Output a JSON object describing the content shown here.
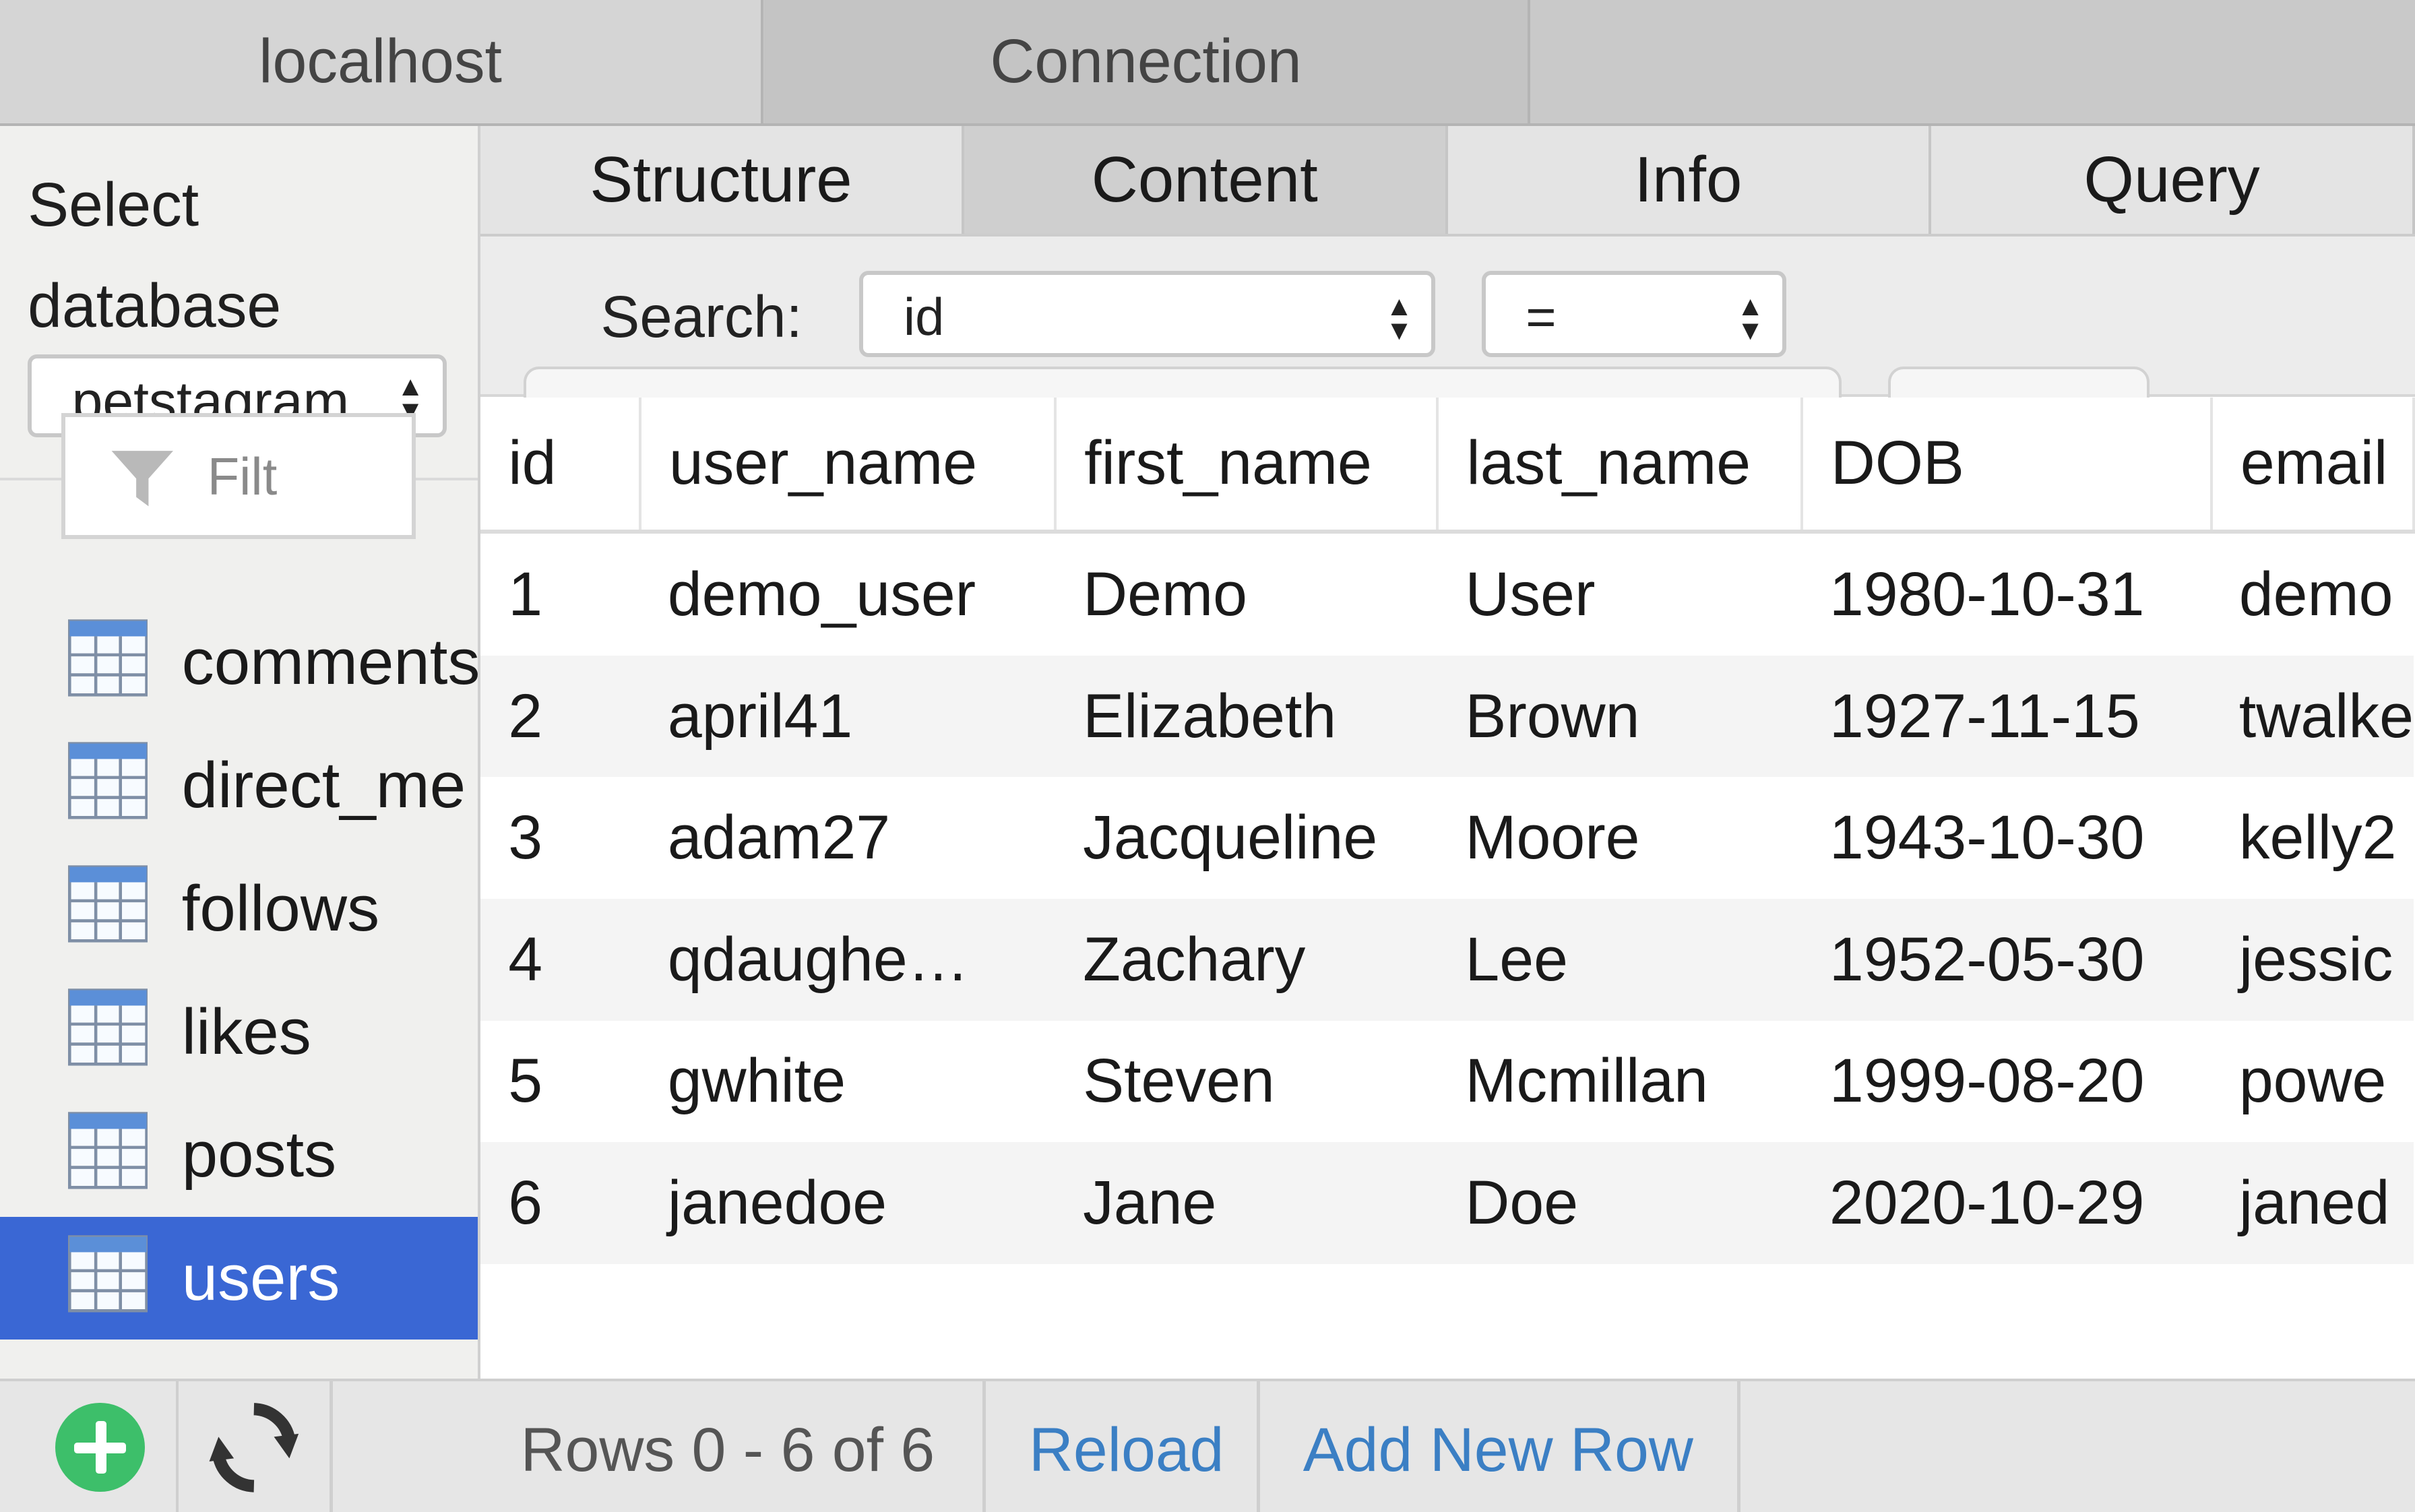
{
  "top_tabs": [
    "localhost",
    "Connection"
  ],
  "sidebar": {
    "select_label": "Select database",
    "database": "petstagram",
    "filter_placeholder": "Filt",
    "tables": [
      {
        "label": "comments",
        "active": false
      },
      {
        "label": "direct_me",
        "active": false
      },
      {
        "label": "follows",
        "active": false
      },
      {
        "label": "likes",
        "active": false
      },
      {
        "label": "posts",
        "active": false
      },
      {
        "label": "users",
        "active": true
      }
    ]
  },
  "tabs": [
    {
      "label": "Structure",
      "active": false
    },
    {
      "label": "Content",
      "active": true
    },
    {
      "label": "Info",
      "active": false
    },
    {
      "label": "Query",
      "active": false
    }
  ],
  "search": {
    "label": "Search:",
    "field": "id",
    "operator": "="
  },
  "table": {
    "columns": [
      "id",
      "user_name",
      "first_name",
      "last_name",
      "DOB",
      "email"
    ],
    "rows": [
      [
        "1",
        "demo_user",
        "Demo",
        "User",
        "1980-10-31",
        "demo"
      ],
      [
        "2",
        "april41",
        "Elizabeth",
        "Brown",
        "1927-11-15",
        "twalke"
      ],
      [
        "3",
        "adam27",
        "Jacqueline",
        "Moore",
        "1943-10-30",
        "kelly2"
      ],
      [
        "4",
        "qdaughe…",
        "Zachary",
        "Lee",
        "1952-05-30",
        "jessic"
      ],
      [
        "5",
        "gwhite",
        "Steven",
        "Mcmillan",
        "1999-08-20",
        "powe"
      ],
      [
        "6",
        "janedoe",
        "Jane",
        "Doe",
        "2020-10-29",
        "janed"
      ]
    ]
  },
  "footer": {
    "rows_count": "Rows 0 - 6 of 6",
    "reload": "Reload",
    "add_row": "Add New Row"
  },
  "icons": {
    "add": "plus-circle-icon",
    "refresh": "refresh-icon",
    "filter": "funnel-icon",
    "table": "table-icon"
  },
  "colors": {
    "selection": "#3a67d4",
    "link": "#3b7fc4",
    "add_button": "#3dbf6a"
  }
}
